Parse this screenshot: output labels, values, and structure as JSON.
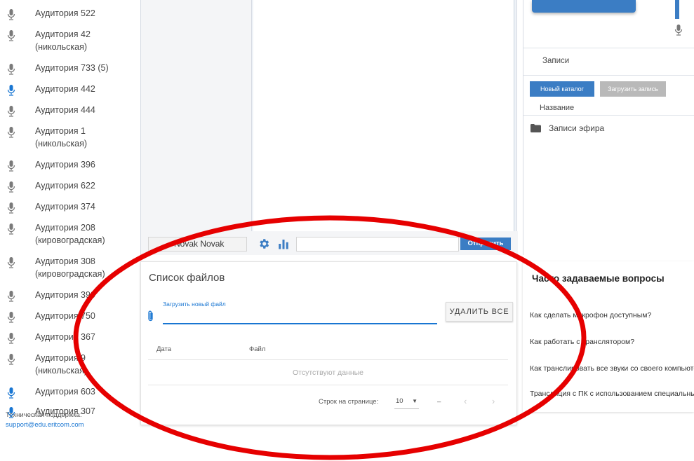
{
  "sidebar": {
    "rooms": [
      {
        "label": "Аудитория 522",
        "active": false
      },
      {
        "label": "Аудитория 42 (никольская)",
        "active": false
      },
      {
        "label": "Аудитория 733 (5)",
        "active": false
      },
      {
        "label": "Аудитория 442",
        "active": true
      },
      {
        "label": "Аудитория 444",
        "active": false
      },
      {
        "label": "Аудитория 1 (никольская)",
        "active": false
      },
      {
        "label": "Аудитория 396",
        "active": false
      },
      {
        "label": "Аудитория 622",
        "active": false
      },
      {
        "label": "Аудитория 374",
        "active": false
      },
      {
        "label": "Аудитория 208 (кировоградская)",
        "active": false
      },
      {
        "label": "Аудитория 308 (кировоградская)",
        "active": false
      },
      {
        "label": "Аудитория 390",
        "active": false
      },
      {
        "label": "Аудитория 750",
        "active": false
      },
      {
        "label": "Аудитория 367",
        "active": false
      },
      {
        "label": "Аудитория 9 (никольская)",
        "active": false
      },
      {
        "label": "Аудитория 603",
        "active": true
      },
      {
        "label": "Аудитория 307",
        "active": true
      }
    ],
    "support_label": "Техническая поддержка:",
    "support_email": "support@edu.eritcom.com"
  },
  "chat": {
    "user_name": "Novak Novak",
    "message_placeholder": "",
    "send_label": "Отправить",
    "settings_icon": "gear-icon",
    "stats_icon": "bar-chart-icon"
  },
  "files": {
    "title": "Список файлов",
    "upload_label": "Загрузить новый файл",
    "delete_all_label": "УДАЛИТЬ ВСЕ",
    "columns": [
      "Дата",
      "Файл"
    ],
    "no_data": "Отсутствуют данные",
    "rows_per_page_label": "Строк на странице:",
    "rows_per_page_value": "10",
    "range_text": "–",
    "prev_icon": "‹",
    "next_icon": "›"
  },
  "records": {
    "title": "Записи",
    "new_folder_label": "Новый каталог",
    "upload_record_label": "Загрузить запись",
    "name_column": "Название",
    "folders": [
      "Записи эфира"
    ]
  },
  "faq": {
    "title": "Часто задаваемые вопросы",
    "questions": [
      "Как сделать микрофон доступным?",
      "Как работать с транслятором?",
      "Как транслировать все звуки со своего компьютера",
      "Трансляция с ПК с использованием специальных программ"
    ]
  },
  "colors": {
    "accent": "#3b7dc4",
    "mic_inactive": "#7a7a7a",
    "mic_active": "#1976d2",
    "annotation": "#e60000"
  }
}
